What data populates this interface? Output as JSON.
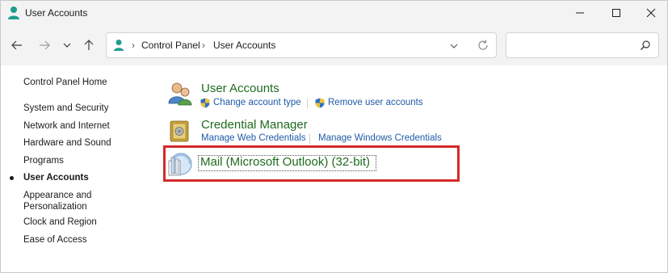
{
  "window": {
    "title": "User Accounts"
  },
  "address_bar": {
    "crumbs": [
      "Control Panel",
      "User Accounts"
    ],
    "search_placeholder": ""
  },
  "left_pane": {
    "home": "Control Panel Home",
    "items": [
      {
        "label": "System and Security",
        "active": false
      },
      {
        "label": "Network and Internet",
        "active": false
      },
      {
        "label": "Hardware and Sound",
        "active": false
      },
      {
        "label": "Programs",
        "active": false
      },
      {
        "label": "User Accounts",
        "active": true
      },
      {
        "label": "Appearance and Personalization",
        "active": false
      },
      {
        "label": "Clock and Region",
        "active": false
      },
      {
        "label": "Ease of Access",
        "active": false
      }
    ]
  },
  "categories": {
    "user_accounts": {
      "title": "User Accounts",
      "links": [
        "Change account type",
        "Remove user accounts"
      ]
    },
    "credential_manager": {
      "title": "Credential Manager",
      "links": [
        "Manage Web Credentials",
        "Manage Windows Credentials"
      ]
    },
    "mail": {
      "title": "Mail (Microsoft Outlook) (32-bit)"
    }
  },
  "colors": {
    "category_title": "#1e6b1e",
    "link": "#1f5aa8",
    "highlight_border": "#d42a2a",
    "chrome_bg": "#f3f3f3"
  }
}
